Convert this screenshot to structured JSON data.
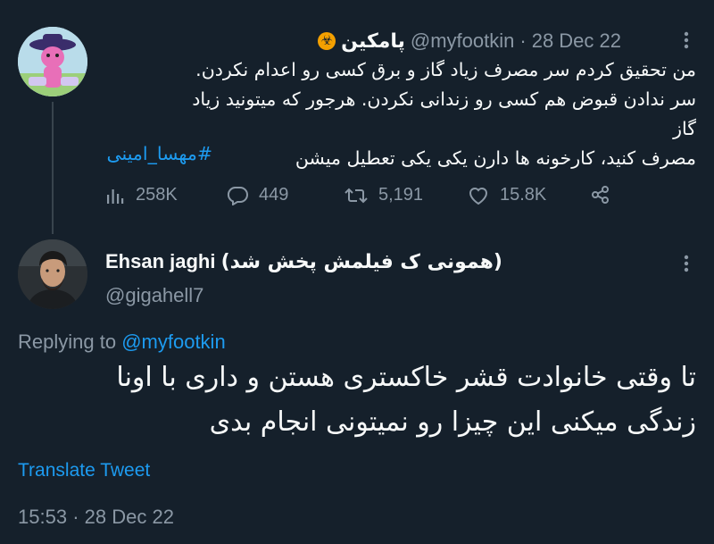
{
  "parent_tweet": {
    "display_name": "پامکین",
    "badge_icon": "biohazard-icon",
    "handle": "@myfootkin",
    "separator": "·",
    "date": "28 Dec 22",
    "text_lines": [
      "من تحقیق کردم سر مصرف زیاد گاز و برق کسی رو اعدام نکردن.",
      "سر ندادن قبوض هم کسی رو زندانی نکردن. هرجور که میتونید زیاد گاز",
      "مصرف کنید، کارخونه ها دارن یکی یکی تعطیل میشن"
    ],
    "hashtag": "#مهسا_امینی",
    "stats": {
      "views": "258K",
      "replies": "449",
      "retweets": "5,191",
      "likes": "15.8K"
    }
  },
  "reply_tweet": {
    "display_name": "Ehsan jaghi",
    "display_name_suffix": "(همونی ک فیلمش پخش شد)",
    "handle": "@gigahell7",
    "replying_label": "Replying to",
    "replying_handle": "@myfootkin",
    "text_lines": [
      "تا وقتی خانوادت قشر خاکستری هستن و داری با اونا",
      "زندگی میکنی این چیزا رو نمیتونی انجام بدی"
    ],
    "translate_label": "Translate Tweet",
    "time": "15:53",
    "separator": "·",
    "date": "28 Dec 22"
  },
  "colors": {
    "background": "#15202b",
    "text": "#f7f9f9",
    "muted": "#8b98a5",
    "accent": "#1d9bf0",
    "thread_line": "#38444d"
  }
}
